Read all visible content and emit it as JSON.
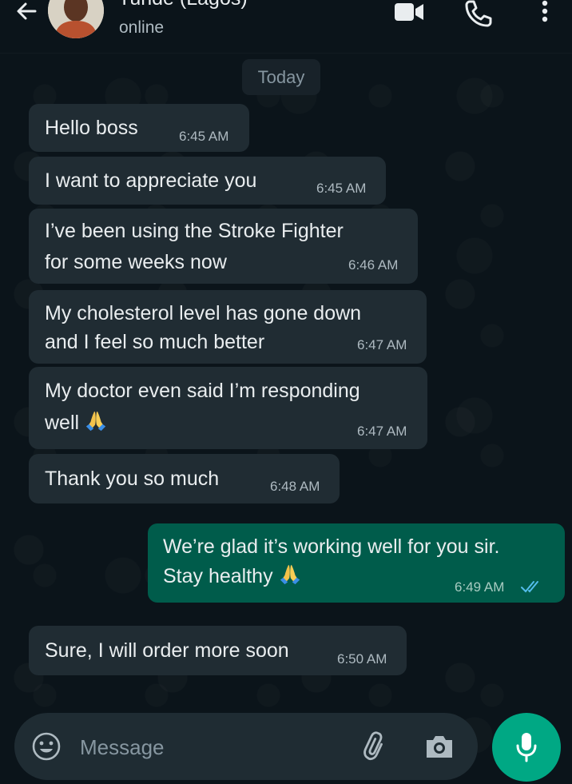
{
  "header": {
    "contact_name": "Tunde (Lagos)",
    "status": "online",
    "icons": [
      "back-arrow-icon",
      "video-call-icon",
      "phone-icon",
      "more-options-icon"
    ]
  },
  "date_divider": "Today",
  "messages": [
    {
      "direction": "incoming",
      "lines": [
        "Hello boss"
      ],
      "time": "6:45 AM"
    },
    {
      "direction": "incoming",
      "lines": [
        "I want to appreciate you"
      ],
      "time": "6:45 AM"
    },
    {
      "direction": "incoming",
      "lines": [
        "I’ve been using the Stroke Fighter",
        "for some weeks now"
      ],
      "time": "6:46 AM"
    },
    {
      "direction": "incoming",
      "lines": [
        "My cholesterol level has gone down",
        "and I feel so much better"
      ],
      "time": "6:47 AM"
    },
    {
      "direction": "incoming",
      "lines": [
        "My doctor even said I’m responding",
        "well"
      ],
      "emoji": "praying-hands",
      "time": "6:47 AM"
    },
    {
      "direction": "incoming",
      "lines": [
        "Thank you so much"
      ],
      "time": "6:48 AM"
    },
    {
      "direction": "outgoing",
      "lines": [
        "We’re glad it’s working well for you sir.",
        "Stay healthy"
      ],
      "emoji": "praying-hands",
      "time": "6:49 AM",
      "status": "read"
    },
    {
      "direction": "incoming",
      "lines": [
        "Sure, I will order more soon"
      ],
      "time": "6:50 AM"
    }
  ],
  "composer": {
    "placeholder": "Message",
    "icons": [
      "emoji-icon",
      "attach-icon",
      "camera-icon",
      "microphone-icon"
    ]
  },
  "colors": {
    "background": "#0b141a",
    "incoming_bubble": "#202c33",
    "outgoing_bubble": "#005c4b",
    "accent": "#00a884",
    "read_ticks": "#53bdeb"
  }
}
